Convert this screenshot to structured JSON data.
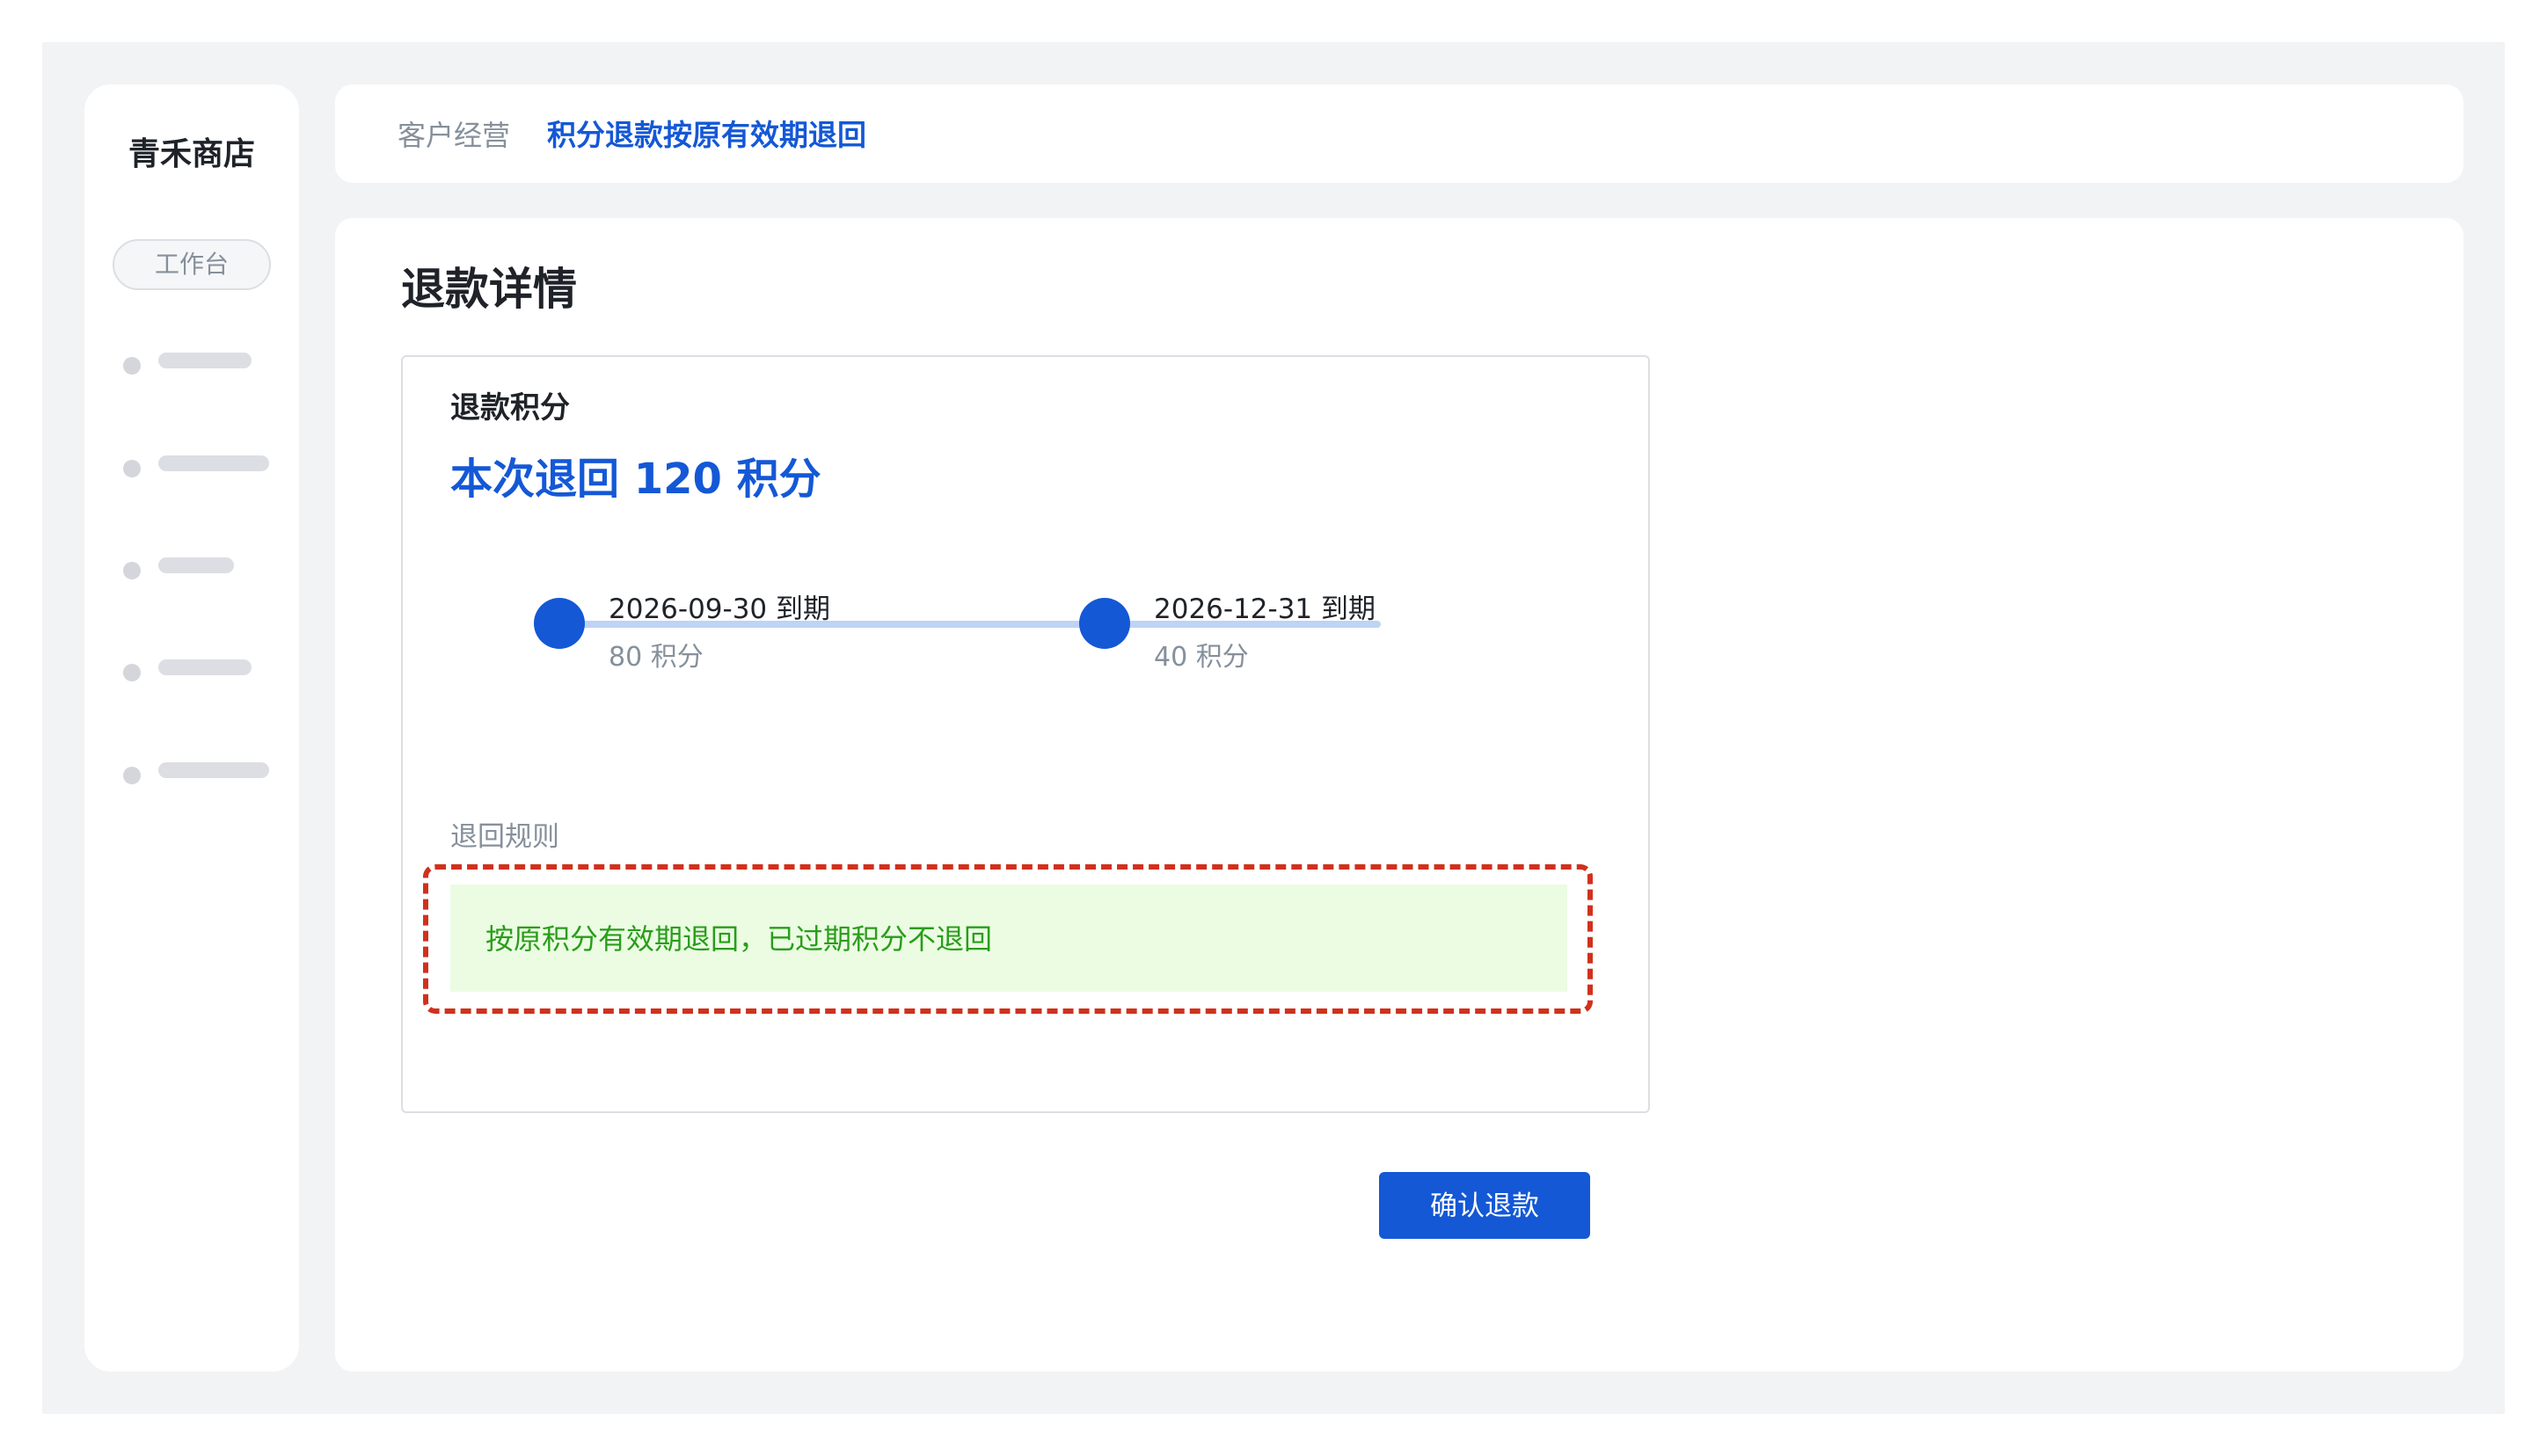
{
  "sidebar": {
    "brand": "青禾商店",
    "workbench_label": "工作台",
    "nav_placeholders": 5
  },
  "header": {
    "breadcrumb_parent": "客户经营",
    "breadcrumb_current": "积分退款按原有效期退回"
  },
  "main": {
    "page_title": "退款详情",
    "section_label": "退款积分",
    "refund_summary": "本次退回 120 积分",
    "timeline": [
      {
        "date_label": "2026-09-30 到期",
        "points_label": "80 积分"
      },
      {
        "date_label": "2026-12-31 到期",
        "points_label": "40 积分"
      }
    ],
    "rules_label": "退回规则",
    "rules_text": "按原积分有效期退回，已过期积分不退回",
    "confirm_button_label": "确认退款"
  },
  "colors": {
    "accent": "#1458d6",
    "timeline_track": "#bed3f5",
    "rules_background": "#ebfce3",
    "rules_text": "#2a9d1a",
    "highlight_border": "#d0311d"
  }
}
